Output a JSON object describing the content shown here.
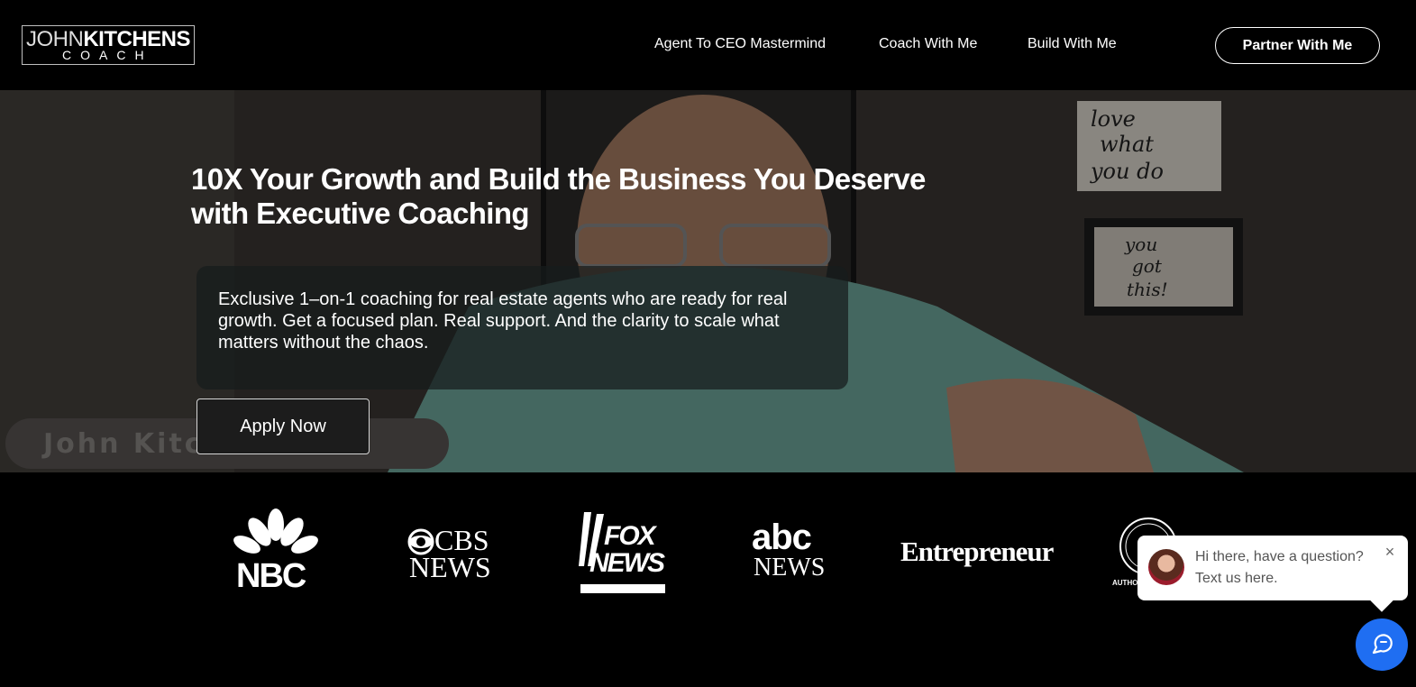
{
  "header": {
    "logo": {
      "line1_thin": "JOHN",
      "line1_bold": "KITCHENS",
      "line2": "COACH"
    },
    "nav": [
      {
        "label": "Agent To CEO Mastermind"
      },
      {
        "label": "Coach With Me"
      },
      {
        "label": "Build With Me"
      }
    ],
    "cta_label": "Partner With Me"
  },
  "hero": {
    "title_line1": "10X Your Growth and Build the Business You Deserve",
    "title_line2": "with Executive Coaching",
    "description": "Exclusive 1–on-1 coaching for real estate agents who are ready for real growth. Get a focused plan. Real support. And the clarity to scale what matters without the chaos.",
    "apply_label": "Apply Now",
    "bg_nameplate": "John Kitchens",
    "bg_sign1": [
      "love",
      "what",
      "you do"
    ],
    "bg_sign2": [
      "you",
      "got",
      "this!"
    ]
  },
  "press": {
    "logos": [
      {
        "name": "nbc-logo",
        "text": "NBC"
      },
      {
        "name": "cbs-news-logo",
        "line1": "CBS",
        "line2": "NEWS"
      },
      {
        "name": "fox-news-logo",
        "line1": "FOX",
        "line2": "NEWS"
      },
      {
        "name": "abc-news-logo",
        "line1": "abc",
        "line2": "NEWS"
      },
      {
        "name": "entrepreneur-logo",
        "text": "Entrepreneur"
      },
      {
        "name": "authority-seal-logo",
        "text": "AUTHO"
      }
    ]
  },
  "chat": {
    "message": "Hi there, have a question? Text us here.",
    "close_icon": "close-icon",
    "launcher_icon": "chat-icon"
  },
  "colors": {
    "background": "#000000",
    "chat_launcher": "#1f6ef2",
    "card": "rgba(22,28,28,0.72)"
  }
}
